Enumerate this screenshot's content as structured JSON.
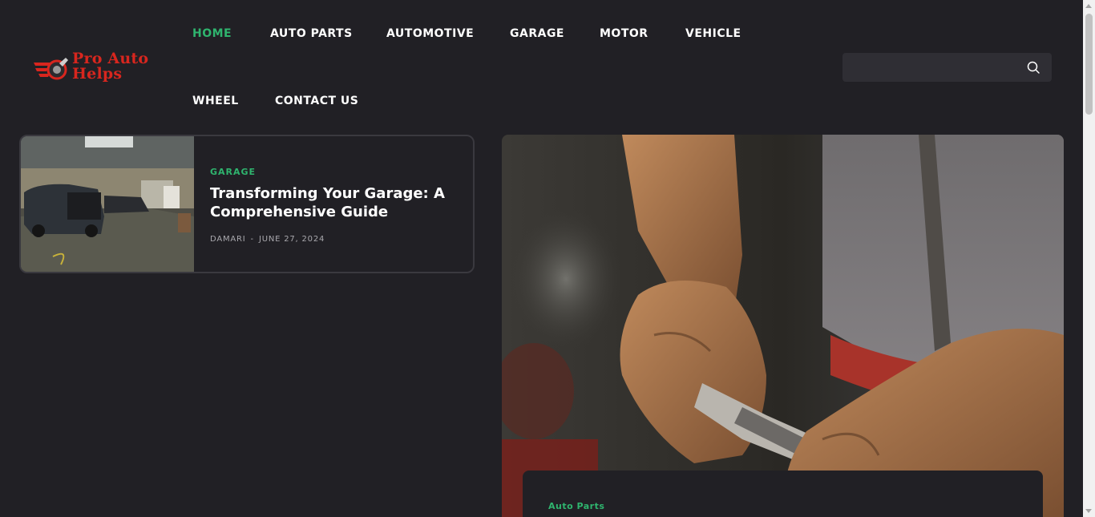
{
  "site": {
    "logo_line1": "Pro Auto",
    "logo_line2": "Helps",
    "logo_icon": "wrench-wheel-icon"
  },
  "nav": {
    "items": [
      {
        "label": "HOME",
        "active": true
      },
      {
        "label": "AUTO PARTS",
        "active": false
      },
      {
        "label": "AUTOMOTIVE",
        "active": false
      },
      {
        "label": "GARAGE",
        "active": false
      },
      {
        "label": "MOTOR",
        "active": false
      },
      {
        "label": "VEHICLE",
        "active": false
      },
      {
        "label": "WHEEL",
        "active": false
      },
      {
        "label": "CONTACT US",
        "active": false
      }
    ]
  },
  "search": {
    "placeholder": "",
    "icon": "search-icon"
  },
  "featured_card": {
    "category": "GARAGE",
    "title": "Transforming Your Garage: A Comprehensive Guide",
    "author": "DAMARI",
    "separator": "-",
    "date": "JUNE 27, 2024"
  },
  "hero": {
    "category": "Auto Parts"
  },
  "colors": {
    "background": "#212025",
    "accent_green": "#2fb46e",
    "logo_red": "#d8261e",
    "text": "#ffffff",
    "meta_text": "#a9a8ad"
  }
}
